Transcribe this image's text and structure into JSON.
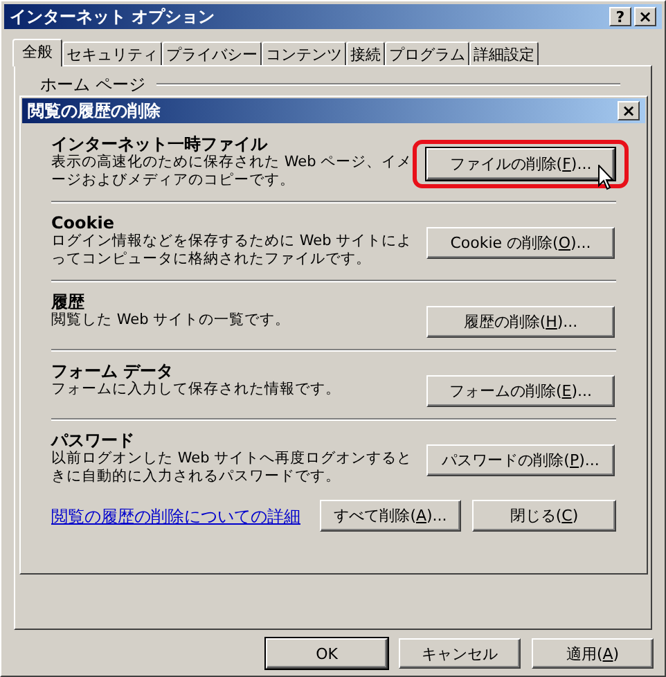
{
  "window": {
    "title": "インターネット オプション",
    "help_button": "?",
    "close_button": "×"
  },
  "tabs": [
    {
      "label": "全般",
      "selected": true
    },
    {
      "label": "セキュリティ",
      "selected": false
    },
    {
      "label": "プライバシー",
      "selected": false
    },
    {
      "label": "コンテンツ",
      "selected": false
    },
    {
      "label": "接続",
      "selected": false
    },
    {
      "label": "プログラム",
      "selected": false
    },
    {
      "label": "詳細設定",
      "selected": false
    }
  ],
  "group_label": "ホーム ページ",
  "dialog": {
    "title": "閲覧の履歴の削除",
    "close_button": "×",
    "sections": [
      {
        "heading": "インターネット一時ファイル",
        "description": "表示の高速化のために保存された Web ページ、イメージおよびメディアのコピーです。",
        "button": {
          "before": "ファイルの削除(",
          "access_key": "F",
          "after": ")..."
        },
        "highlighted": true
      },
      {
        "heading": "Cookie",
        "description": "ログイン情報などを保存するために Web サイトによってコンピュータに格納されたファイルです。",
        "button": {
          "before": "Cookie の削除(",
          "access_key": "O",
          "after": ")..."
        },
        "highlighted": false
      },
      {
        "heading": "履歴",
        "description": "閲覧した Web サイトの一覧です。",
        "button": {
          "before": "履歴の削除(",
          "access_key": "H",
          "after": ")..."
        },
        "highlighted": false
      },
      {
        "heading": "フォーム データ",
        "description": "フォームに入力して保存された情報です。",
        "button": {
          "before": "フォームの削除(",
          "access_key": "E",
          "after": ")..."
        },
        "highlighted": false
      },
      {
        "heading": "パスワード",
        "description": "以前ログオンした Web サイトへ再度ログオンするときに自動的に入力されるパスワードです。",
        "button": {
          "before": "パスワードの削除(",
          "access_key": "P",
          "after": ")..."
        },
        "highlighted": false
      }
    ],
    "link": "閲覧の履歴の削除についての詳細",
    "buttons": [
      {
        "before": "すべて削除(",
        "access_key": "A",
        "after": ")..."
      },
      {
        "before": "閉じる(",
        "access_key": "C",
        "after": ")"
      }
    ]
  },
  "buttons": [
    {
      "before": "OK"
    },
    {
      "before": "キャンセル"
    },
    {
      "before": "適用(",
      "access_key": "A",
      "after": ")"
    }
  ]
}
